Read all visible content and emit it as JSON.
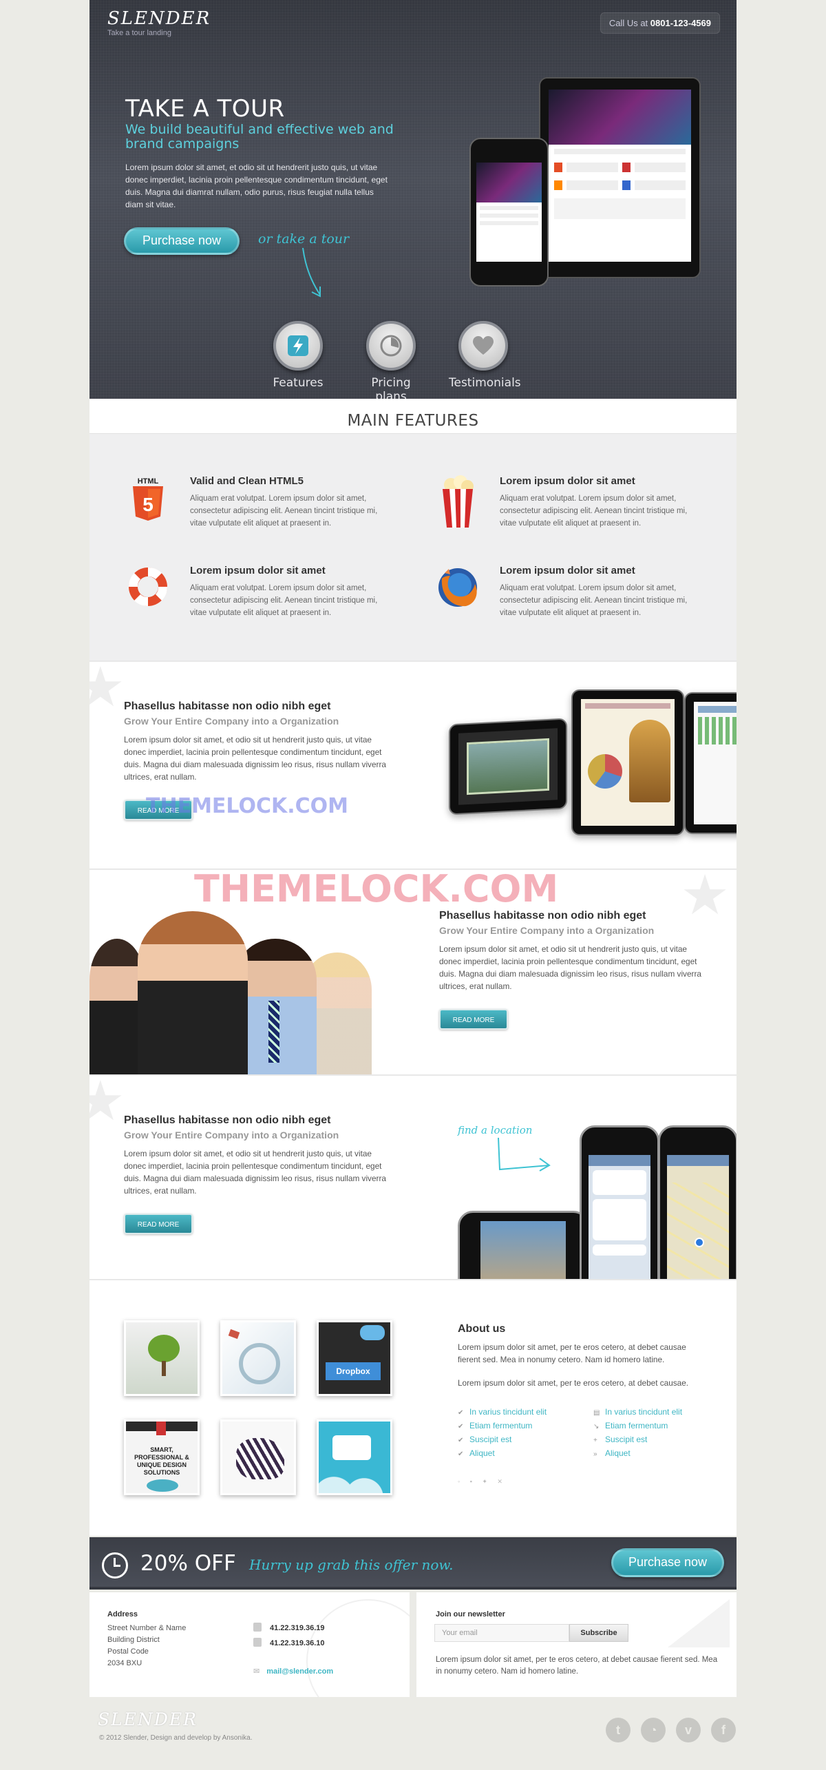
{
  "header": {
    "logo": "SLENDER",
    "tagline": "Take a tour landing",
    "call_prefix": "Call Us at",
    "phone": "0801-123-4569"
  },
  "hero": {
    "title": "TAKE A TOUR",
    "subtitle": "We build beautiful and effective web and brand campaigns",
    "text": "Lorem ipsum dolor sit amet, et odio sit ut hendrerit justo quis, ut vitae donec imperdiet, lacinia proin pellentesque condimentum tincidunt, eget duis. Magna dui diamrat nullam, odio purus, risus feugiat nulla tellus diam sit vitae.",
    "purchase_label": "Purchase now",
    "tour_label": "or take a tour",
    "nav": [
      {
        "label": "Features",
        "icon": "lightning-icon"
      },
      {
        "label": "Pricing plans",
        "icon": "pie-chart-icon"
      },
      {
        "label": "Testimonials",
        "icon": "heart-icon"
      }
    ]
  },
  "main_features": {
    "heading": "MAIN FEATURES",
    "items": [
      {
        "title": "Valid and Clean HTML5",
        "text": "Aliquam erat volutpat. Lorem ipsum dolor sit amet, consectetur adipiscing elit. Aenean tincint tristique mi, vitae vulputate elit aliquet at praesent in.",
        "icon": "html5-icon"
      },
      {
        "title": "Lorem ipsum dolor sit amet",
        "text": "Aliquam erat volutpat. Lorem ipsum dolor sit amet, consectetur adipiscing elit. Aenean tincint tristique mi, vitae vulputate elit aliquet at praesent in.",
        "icon": "popcorn-icon"
      },
      {
        "title": "Lorem ipsum dolor sit amet",
        "text": "Aliquam erat volutpat. Lorem ipsum dolor sit amet, consectetur adipiscing elit. Aenean tincint tristique mi, vitae vulputate elit aliquet at praesent in.",
        "icon": "lifebuoy-icon"
      },
      {
        "title": "Lorem ipsum dolor sit amet",
        "text": "Aliquam erat volutpat. Lorem ipsum dolor sit amet, consectetur adipiscing elit. Aenean tincint tristique mi, vitae vulputate elit aliquet at praesent in.",
        "icon": "firefox-icon"
      }
    ]
  },
  "blocks": [
    {
      "title": "Phasellus habitasse non odio nibh eget",
      "subtitle": "Grow Your Entire Company into a Organization",
      "text": "Lorem ipsum dolor sit amet, et odio sit ut hendrerit justo quis, ut vitae donec imperdiet, lacinia proin pellentesque condimentum tincidunt, eget duis. Magna dui diam malesuada dignissim leo risus, risus nullam viverra ultrices, erat nullam.",
      "button": "READ MORE"
    },
    {
      "title": "Phasellus habitasse non odio nibh eget",
      "subtitle": "Grow Your Entire Company into a Organization",
      "text": "Lorem ipsum dolor sit amet, et odio sit ut hendrerit justo quis, ut vitae donec imperdiet, lacinia proin pellentesque condimentum tincidunt, eget duis. Magna dui diam malesuada dignissim leo risus, risus nullam viverra ultrices, erat nullam.",
      "button": "READ MORE"
    },
    {
      "title": "Phasellus habitasse non odio nibh eget",
      "subtitle": "Grow Your Entire Company into a Organization",
      "text": "Lorem ipsum dolor sit amet, et odio sit ut hendrerit justo quis, ut vitae donec imperdiet, lacinia proin pellentesque condimentum tincidunt, eget duis. Magna dui diam malesuada dignissim leo risus, risus nullam viverra ultrices, erat nullam.",
      "button": "READ MORE",
      "annotation": "find a location"
    }
  ],
  "watermark": "THEMELOCK.COM",
  "about": {
    "title": "About us",
    "text1": "Lorem ipsum dolor sit amet, per te eros cetero, at debet causae fierent sed. Mea in nonumy cetero. Nam id homero latine.",
    "text2": "Lorem ipsum dolor sit amet, per te eros cetero, at debet causae.",
    "list_left": [
      "In varius tincidunt elit",
      "Etiam fermentum",
      "Suscipit est",
      "Aliquet"
    ],
    "list_right": [
      "In varius tincidunt elit",
      "Etiam fermentum",
      "Suscipit est",
      "Aliquet"
    ],
    "gallery_texts": {
      "dropbox": "Dropbox",
      "web": "SMART, PROFESSIONAL & UNIQUE DESIGN SOLUTIONS"
    }
  },
  "offer": {
    "percent": "20% OFF",
    "hurry": "Hurry up grab this offer now.",
    "button": "Purchase now"
  },
  "contact": {
    "heading": "Address",
    "address_lines": [
      "Street Number & Name",
      "Building District",
      "Postal Code",
      "2034 BXU"
    ],
    "phone1": "41.22.319.36.19",
    "phone2": "41.22.319.36.10",
    "email": "mail@slender.com"
  },
  "newsletter": {
    "heading": "Join our newsletter",
    "placeholder": "Your email",
    "button": "Subscribe",
    "text": "Lorem ipsum dolor sit amet, per te eros cetero, at debet causae fierent sed. Mea in nonumy cetero. Nam id homero latine."
  },
  "footer": {
    "logo": "SLENDER",
    "copyright": "© 2012 Slender, Design and develop by Ansonika."
  },
  "colors": {
    "accent": "#3fc3d3",
    "dark": "#43464f"
  }
}
